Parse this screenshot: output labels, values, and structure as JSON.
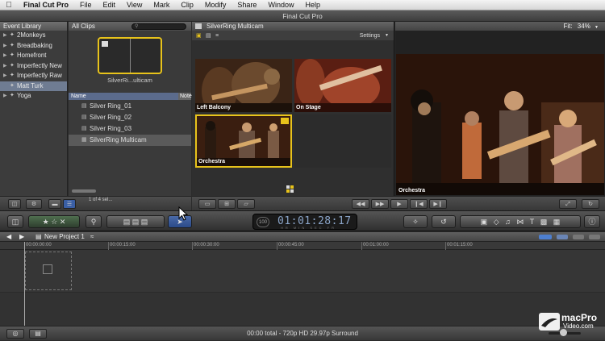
{
  "menubar": {
    "apple_icon": "apple-icon",
    "app": "Final Cut Pro",
    "items": [
      "File",
      "Edit",
      "View",
      "Mark",
      "Clip",
      "Modify",
      "Share",
      "Window",
      "Help"
    ]
  },
  "window_title": "Final Cut Pro",
  "event_library": {
    "title": "Event Library",
    "items": [
      {
        "label": "2Monkeys",
        "selected": false
      },
      {
        "label": "Breadbaking",
        "selected": false
      },
      {
        "label": "Homefront",
        "selected": false
      },
      {
        "label": "Imperfectly New",
        "selected": false
      },
      {
        "label": "Imperfectly Raw",
        "selected": false
      },
      {
        "label": "Matt Turk",
        "selected": true
      },
      {
        "label": "Yoga",
        "selected": false
      }
    ]
  },
  "browser": {
    "filter": "All Clips",
    "filmstrip_name": "SilverRi...ulticam",
    "columns": {
      "name": "Name",
      "notes": "Note"
    },
    "clips": [
      {
        "label": "Silver Ring_01",
        "selected": false
      },
      {
        "label": "Silver Ring_02",
        "selected": false
      },
      {
        "label": "Silver Ring_03",
        "selected": false
      },
      {
        "label": "SilverRing Multicam",
        "selected": true
      }
    ],
    "selection_count": "1 of 4 sel..."
  },
  "angle_viewer": {
    "title": "SilverRing Multicam",
    "settings_label": "Settings",
    "angles": [
      {
        "label": "Left Balcony",
        "active": false
      },
      {
        "label": "On Stage",
        "active": false
      },
      {
        "label": "Orchestra",
        "active": true
      }
    ]
  },
  "viewer": {
    "fit_label": "Fit:",
    "zoom": "34%",
    "angle_label": "Orchestra"
  },
  "timecode": {
    "percent": "100",
    "value": "01:01:28:17",
    "units": "HR MIN SEC FR"
  },
  "timeline": {
    "project_name": "New Project 1",
    "ruler_ticks": [
      "00:00:00:00",
      "00:00:15:00",
      "00:00:30:00",
      "00:00:45:00",
      "00:01:00:00",
      "00:01:15:00"
    ]
  },
  "status_bar": {
    "text": "00:00 total - 720p HD 29.97p Surround"
  },
  "watermark": {
    "line1": "macPro",
    "line2": "Video.com"
  },
  "colors": {
    "accent_yellow": "#e8c31b",
    "selection_blue": "#5b6b8c",
    "timecode_text": "#8aa4c8"
  }
}
